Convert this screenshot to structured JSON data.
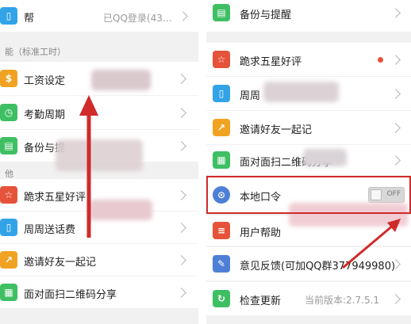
{
  "left": {
    "account_row": {
      "label": "帮",
      "value": "已QQ登录(43…",
      "icon": "phone-icon",
      "color": "#33a3e8"
    },
    "section_header": "能（标准工时）",
    "items": [
      {
        "label": "工资设定",
        "icon": "coin-icon",
        "color": "#f0a322"
      },
      {
        "label": "考勤周期",
        "icon": "clock-icon",
        "color": "#3fbf63"
      },
      {
        "label": "备份与提",
        "icon": "file-icon",
        "color": "#3fbf63"
      }
    ],
    "section2_header": "他",
    "items2": [
      {
        "label": "跪求五星好评",
        "icon": "star-icon",
        "color": "#e5533a"
      },
      {
        "label": "周周送话费",
        "icon": "phone-icon",
        "color": "#33a3e8"
      },
      {
        "label": "邀请好友一起记",
        "icon": "trend-icon",
        "color": "#f0a322"
      },
      {
        "label": "面对面扫二维码分享",
        "icon": "qrcode-icon",
        "color": "#3fbf63"
      }
    ]
  },
  "right": {
    "items": [
      {
        "label": "备份与提醒",
        "icon": "file-icon",
        "color": "#3fbf63"
      },
      {
        "label": "跪求五星好评",
        "icon": "star-icon",
        "color": "#e5533a"
      },
      {
        "label": "周周",
        "icon": "phone-icon",
        "color": "#33a3e8"
      },
      {
        "label": "邀请好友一起记",
        "icon": "trend-icon",
        "color": "#f0a322"
      },
      {
        "label": "面对面扫二维码分享",
        "icon": "qrcode-icon",
        "color": "#3fbf63"
      },
      {
        "label": "本地口令",
        "icon": "lock-icon",
        "color": "#4d7fd6"
      },
      {
        "label": "用户帮助",
        "icon": "doc-icon",
        "color": "#e5533a"
      },
      {
        "label": "意见反馈(可加QQ群377949980)",
        "icon": "edit-icon",
        "color": "#4d7fd6"
      },
      {
        "label": "检查更新",
        "icon": "refresh-icon",
        "color": "#3fbf63"
      }
    ],
    "toggle_text": "OFF",
    "version_text": "当前版本:2.7.5.1"
  },
  "colors": {
    "annotation": "#d02a2a"
  }
}
